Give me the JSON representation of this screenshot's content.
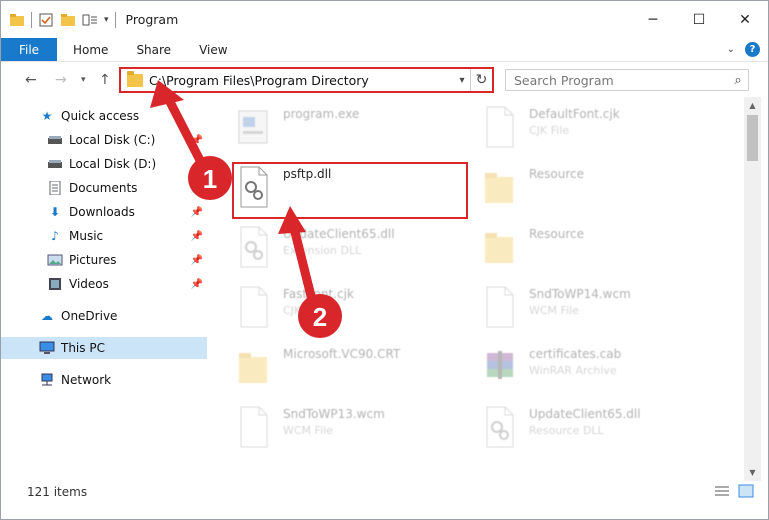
{
  "window": {
    "title": "Program",
    "controls": {
      "minimize": "─",
      "maximize": "☐",
      "close": "✕"
    }
  },
  "ribbon": {
    "tabs": [
      "File",
      "Home",
      "Share",
      "View"
    ]
  },
  "address": {
    "path": "C:\\Program Files\\Program Directory"
  },
  "search": {
    "placeholder": "Search Program"
  },
  "nav": {
    "items": [
      {
        "label": "Quick access",
        "icon": "star-icon"
      },
      {
        "label": "Local Disk (C:)",
        "icon": "drive-icon"
      },
      {
        "label": "Local Disk (D:)",
        "icon": "drive-icon"
      },
      {
        "label": "Documents",
        "icon": "documents-icon"
      },
      {
        "label": "Downloads",
        "icon": "download-icon"
      },
      {
        "label": "Music",
        "icon": "music-icon"
      },
      {
        "label": "Pictures",
        "icon": "pictures-icon"
      },
      {
        "label": "Videos",
        "icon": "videos-icon"
      },
      {
        "label": "OneDrive",
        "icon": "cloud-icon"
      },
      {
        "label": "This PC",
        "icon": "pc-icon"
      },
      {
        "label": "Network",
        "icon": "network-icon"
      }
    ]
  },
  "files": [
    {
      "name": "program.exe",
      "sub": "",
      "col": 0,
      "row": 0,
      "kind": "exe",
      "faded": true
    },
    {
      "name": "DefaultFont.cjk",
      "sub": "CJK File",
      "col": 1,
      "row": 0,
      "kind": "doc",
      "faded": true
    },
    {
      "name": "psftp.dll",
      "sub": "",
      "col": 0,
      "row": 1,
      "kind": "dll",
      "faded": false
    },
    {
      "name": "Resource",
      "sub": "",
      "col": 1,
      "row": 1,
      "kind": "folder",
      "faded": true
    },
    {
      "name": "UpdateClient65.dll",
      "sub": "Extension DLL",
      "col": 0,
      "row": 2,
      "kind": "dll",
      "faded": true
    },
    {
      "name": "Resource",
      "sub": "",
      "col": 1,
      "row": 2,
      "kind": "folder",
      "faded": true
    },
    {
      "name": "FastFont.cjk",
      "sub": "CJK File",
      "col": 0,
      "row": 3,
      "kind": "doc",
      "faded": true
    },
    {
      "name": "SndToWP14.wcm",
      "sub": "WCM File",
      "col": 1,
      "row": 3,
      "kind": "doc",
      "faded": true
    },
    {
      "name": "Microsoft.VC90.CRT",
      "sub": "",
      "col": 0,
      "row": 4,
      "kind": "folder",
      "faded": true
    },
    {
      "name": "certificates.cab",
      "sub": "WinRAR Archive",
      "col": 1,
      "row": 4,
      "kind": "rar",
      "faded": true
    },
    {
      "name": "SndToWP13.wcm",
      "sub": "WCM File",
      "col": 0,
      "row": 5,
      "kind": "doc",
      "faded": true
    },
    {
      "name": "UpdateClient65.dll",
      "sub": "Resource DLL",
      "col": 1,
      "row": 5,
      "kind": "dll",
      "faded": true
    }
  ],
  "status": {
    "count": "121 items"
  },
  "annotations": {
    "step1": "1",
    "step2": "2",
    "color": "#d9262b"
  }
}
